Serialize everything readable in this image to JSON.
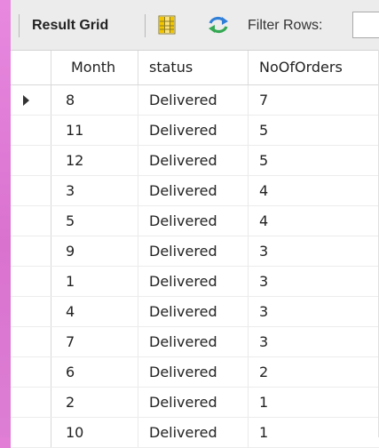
{
  "toolbar": {
    "result_grid_label": "Result Grid",
    "grid_icon": "form-grid-icon",
    "refresh_icon": "refresh-icon",
    "filter_label": "Filter Rows:",
    "filter_value": "",
    "filter_placeholder": ""
  },
  "grid": {
    "columns": [
      "Month",
      "status",
      "NoOfOrders"
    ],
    "selected_row_index": 0,
    "rows": [
      {
        "month": "8",
        "status": "Delivered",
        "orders": "7"
      },
      {
        "month": "11",
        "status": "Delivered",
        "orders": "5"
      },
      {
        "month": "12",
        "status": "Delivered",
        "orders": "5"
      },
      {
        "month": "3",
        "status": "Delivered",
        "orders": "4"
      },
      {
        "month": "5",
        "status": "Delivered",
        "orders": "4"
      },
      {
        "month": "9",
        "status": "Delivered",
        "orders": "3"
      },
      {
        "month": "1",
        "status": "Delivered",
        "orders": "3"
      },
      {
        "month": "4",
        "status": "Delivered",
        "orders": "3"
      },
      {
        "month": "7",
        "status": "Delivered",
        "orders": "3"
      },
      {
        "month": "6",
        "status": "Delivered",
        "orders": "2"
      },
      {
        "month": "2",
        "status": "Delivered",
        "orders": "1"
      },
      {
        "month": "10",
        "status": "Delivered",
        "orders": "1"
      }
    ]
  },
  "colors": {
    "background": "#e27ed6",
    "toolbar": "#ececec",
    "grid_icon_yellow": "#f2c500",
    "refresh_blue": "#2f7fd8"
  }
}
